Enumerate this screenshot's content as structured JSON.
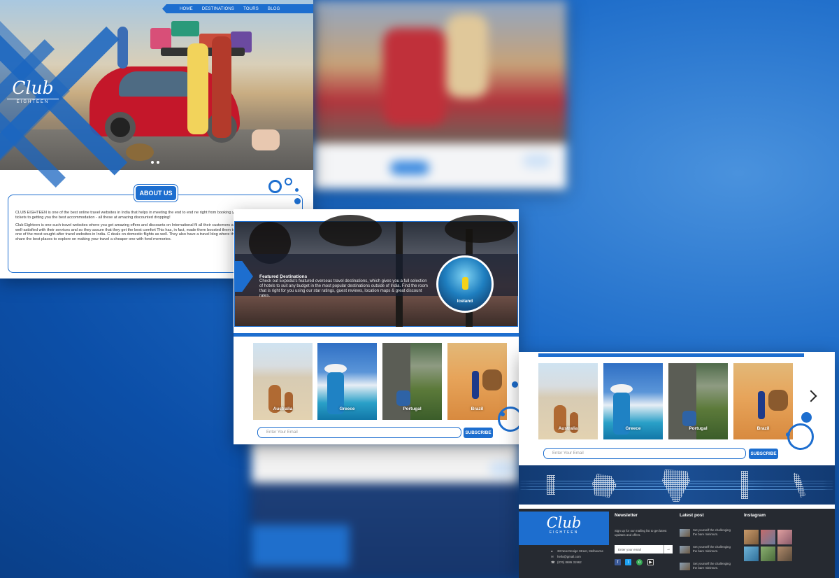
{
  "colors": {
    "brand": "#1d6ecf",
    "background": "#0f55b0",
    "footer": "#262a31"
  },
  "mockup_home": {
    "nav": [
      "HOME",
      "DESTINATIONS",
      "TOURS",
      "BLOG"
    ],
    "logo": {
      "script": "Club",
      "sub": "EIGHTEEN"
    },
    "about": {
      "heading": "ABOUT US",
      "paragraph1": "CLUB EIGHTEEN is one of the best online travel websites in India that helps in meeting the end to end ne right from booking your tickets to getting you the best accommodation - all these at amazing discounted dropping!",
      "paragraph2": "Club Eighteen is one such travel websites where you get amazing offers and discounts on International fli all their customers are well-satisfied with their services and so they assure that they get the best comfort This has, in fact, made them boosted them to be one of the most sought-after travel websites in India. C deals on domestic flights as well. They also have a travel blog where they share the best places to explore on making your travel a cheaper one with fond memories."
    }
  },
  "mockup_destinations": {
    "featured": {
      "title": "Featured Destinations",
      "text": "Check out Expedia's featured overseas travel destinations, which gives you a full selection of hotels to suit any budget in the most popular destinations outside of India. Find the room that is right for you using our star ratings, guest reviews, location maps & great discount rates.",
      "circle_caption": "Iceland"
    },
    "cards": [
      "Australia",
      "Greece",
      "Portugal",
      "Brazil"
    ],
    "email_placeholder": "Enter Your Email",
    "subscribe_label": "SUBSCRIBE"
  },
  "mockup_footer": {
    "cards": [
      "Australia",
      "Greece",
      "Portugal",
      "Brazil"
    ],
    "email_placeholder": "Enter Your Email",
    "subscribe_label": "SUBSCRIBE",
    "footer": {
      "logo_script": "Club",
      "logo_sub": "EIGHTEEN",
      "address": "33 New Design Street, Melbourne",
      "email": "hello@gmail.com",
      "phone": "(076) 8686 31962",
      "newsletter_heading": "Newsletter",
      "newsletter_text": "Sign up for our mailing list to get latest updates and offers.",
      "newsletter_placeholder": "Enter your email",
      "newsletter_button": "→",
      "latest_heading": "Latest post",
      "posts": [
        "Set yourself the challenging the bare minimum.",
        "Set yourself the challenging the bare minimum.",
        "Set yourself the challenging the bare minimum."
      ],
      "instagram_heading": "Instagram",
      "social_icons": [
        "facebook-icon",
        "twitter-icon",
        "tripadvisor-icon",
        "youtube-icon"
      ]
    }
  }
}
